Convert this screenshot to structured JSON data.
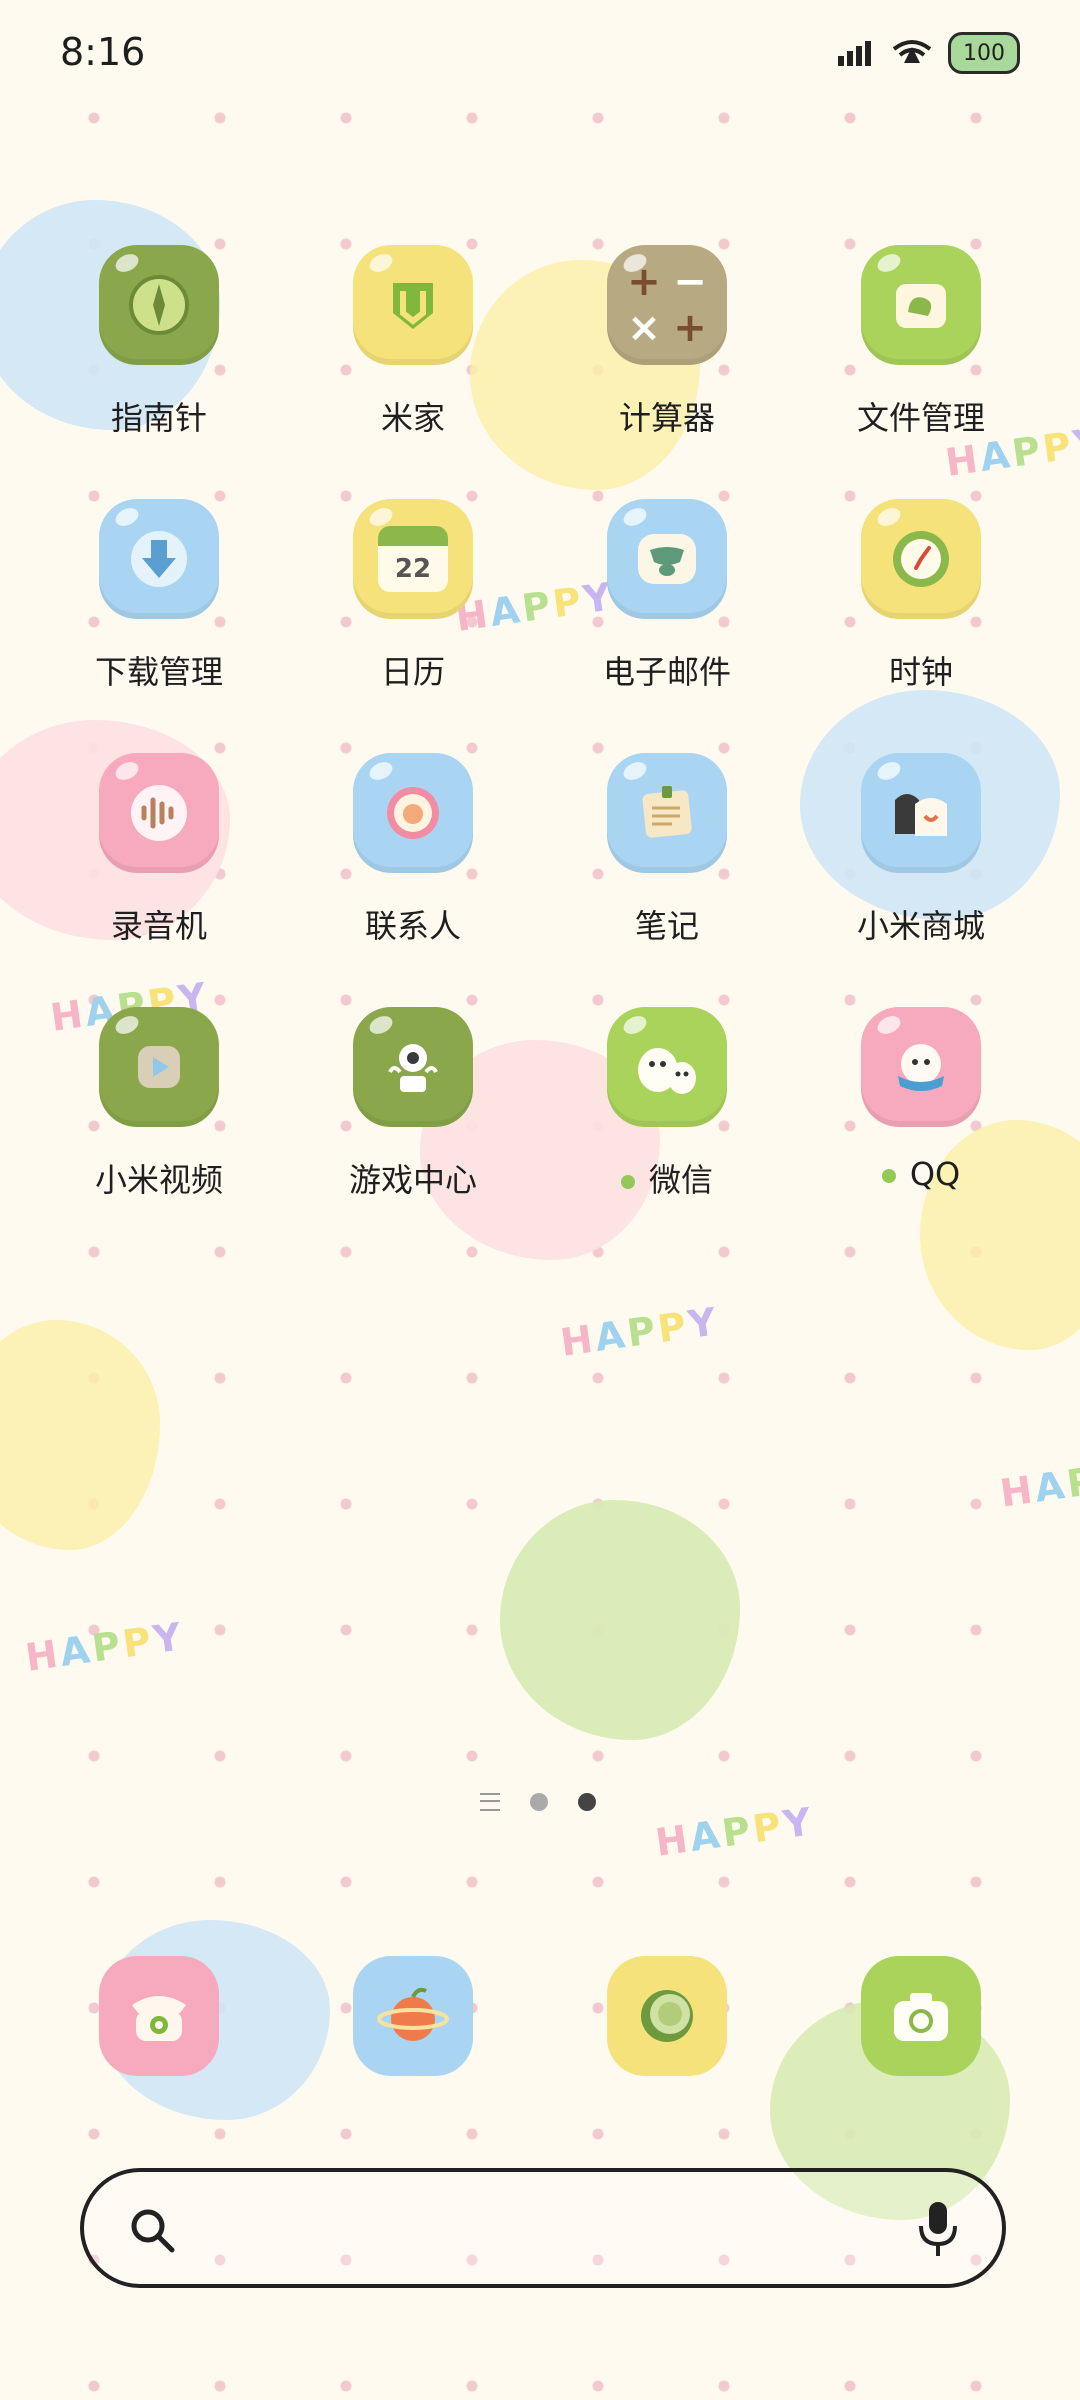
{
  "status_bar": {
    "time": "8:16",
    "battery": "100"
  },
  "apps": [
    {
      "label": "指南针",
      "icon": "compass-icon"
    },
    {
      "label": "米家",
      "icon": "mi-home-icon"
    },
    {
      "label": "计算器",
      "icon": "calculator-icon"
    },
    {
      "label": "文件管理",
      "icon": "file-manager-icon"
    },
    {
      "label": "下载管理",
      "icon": "download-icon"
    },
    {
      "label": "日历",
      "icon": "calendar-icon",
      "badge": "22"
    },
    {
      "label": "电子邮件",
      "icon": "email-icon"
    },
    {
      "label": "时钟",
      "icon": "clock-icon"
    },
    {
      "label": "录音机",
      "icon": "recorder-icon"
    },
    {
      "label": "联系人",
      "icon": "contacts-icon"
    },
    {
      "label": "笔记",
      "icon": "notes-icon"
    },
    {
      "label": "小米商城",
      "icon": "mi-store-icon"
    },
    {
      "label": "小米视频",
      "icon": "mi-video-icon"
    },
    {
      "label": "游戏中心",
      "icon": "game-center-icon"
    },
    {
      "label": "微信",
      "icon": "wechat-icon"
    },
    {
      "label": "QQ",
      "icon": "qq-icon"
    }
  ],
  "dock": [
    {
      "icon": "phone-icon"
    },
    {
      "icon": "browser-icon"
    },
    {
      "icon": "gallery-icon"
    },
    {
      "icon": "camera-icon"
    }
  ],
  "pager": {
    "pages": 2,
    "active": 2
  },
  "wallpaper": {
    "text": "HAPPY"
  },
  "colors": {
    "green": "#8aa84b",
    "yellow": "#f5e27a",
    "blue": "#a9d5f2",
    "pink": "#f7a9be",
    "olive": "#b7aa82",
    "lime": "#a9d35a"
  }
}
